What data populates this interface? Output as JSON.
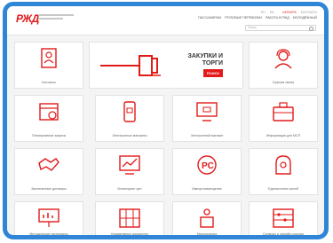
{
  "header": {
    "logo_text": "РЖД",
    "top_links": [
      "Ru",
      "En",
      "",
      "Карьера",
      "Контакты"
    ],
    "nav": [
      "Пассажирам",
      "Грузовые перевозки",
      "Работа в РЖД",
      "Молодёжный"
    ],
    "search_label": "Поиск"
  },
  "procurement": {
    "title_line1": "ЗАКУПКИ И",
    "title_line2": "ТОРГИ",
    "button": "ПОИСК"
  },
  "tiles": [
    {
      "label": "Контакты"
    },
    {
      "label": ""
    },
    {
      "label": "Горячая линия"
    },
    {
      "label": "Планирование закупок"
    },
    {
      "label": "Электронные магазины"
    },
    {
      "label": "Электронный магазин"
    },
    {
      "label": "Информация для МСП"
    },
    {
      "label": "Заключенные договоры"
    },
    {
      "label": "Мониторинг цен"
    },
    {
      "label": "Импортозамещение"
    },
    {
      "label": "Единая книга жалоб"
    },
    {
      "label": "Методические материалы"
    },
    {
      "label": "Нормативные документы"
    },
    {
      "label": "Мероприятия"
    },
    {
      "label": "Сервисы и офлайн-покупки"
    }
  ],
  "colors": {
    "accent": "#e21a1a",
    "frame": "#2f86d6"
  }
}
